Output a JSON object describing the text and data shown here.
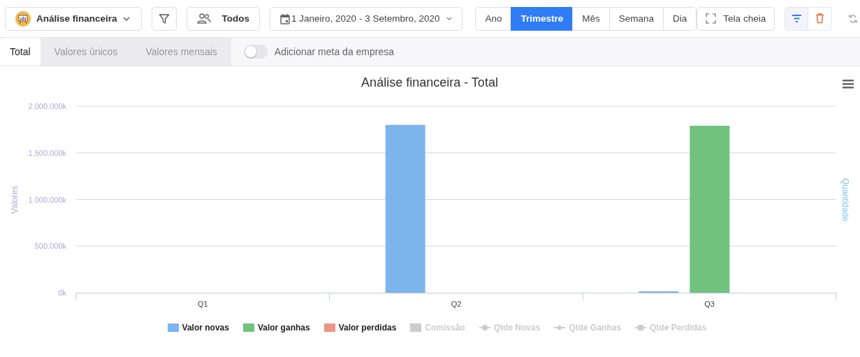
{
  "toolbar": {
    "report": {
      "label": "Análise financeira"
    },
    "owner": {
      "label": "Todos"
    },
    "date_range": {
      "label": "1 Janeiro, 2020 - 3 Setembro, 2020"
    },
    "periods": [
      {
        "label": "Ano",
        "selected": false
      },
      {
        "label": "Trimestre",
        "selected": true
      },
      {
        "label": "Mês",
        "selected": false
      },
      {
        "label": "Semana",
        "selected": false
      },
      {
        "label": "Dia",
        "selected": false
      }
    ],
    "fullscreen": {
      "label": "Tela cheia"
    },
    "view_filter": {
      "selected": true
    }
  },
  "tabs": [
    {
      "label": "Total",
      "selected": true
    },
    {
      "label": "Valores únicos",
      "selected": false
    },
    {
      "label": "Valores mensais",
      "selected": false
    }
  ],
  "goal_toggle": {
    "label": "Adicionar meta da empresa",
    "on": false
  },
  "chart": {
    "chart_data": {
      "type": "bar",
      "title": "Análise financeira - Total",
      "ylabel": "Valores",
      "categories": [
        "Q1",
        "Q2",
        "Q3"
      ],
      "ylim": [
        0,
        2000000
      ],
      "grid": true,
      "legend": "bottom",
      "yticks": [
        {
          "value": 0,
          "label": "0k"
        },
        {
          "value": 500000,
          "label": "500.000k"
        },
        {
          "value": 1000000,
          "label": "1.000.000k"
        },
        {
          "value": 1500000,
          "label": "1.500.000k"
        },
        {
          "value": 2000000,
          "label": "2.000.000k"
        }
      ],
      "series": [
        {
          "name": "Valor novas",
          "color": "#7cb5ec",
          "values": [
            0,
            1800000,
            15000
          ]
        },
        {
          "name": "Valor ganhas",
          "color": "#71c27c",
          "values": [
            0,
            0,
            1790000
          ]
        },
        {
          "name": "Valor perdidas",
          "color": "#ec9487",
          "values": [
            0,
            0,
            0
          ]
        }
      ]
    },
    "right_axis_title": "Quantidade",
    "disabled_legend_items": [
      {
        "label": "Comissão",
        "kind": "bar"
      },
      {
        "label": "Qtde Novas",
        "kind": "circle"
      },
      {
        "label": "Qtde Ganhas",
        "kind": "diamond"
      },
      {
        "label": "Qtde Perdidas",
        "kind": "square"
      }
    ]
  }
}
